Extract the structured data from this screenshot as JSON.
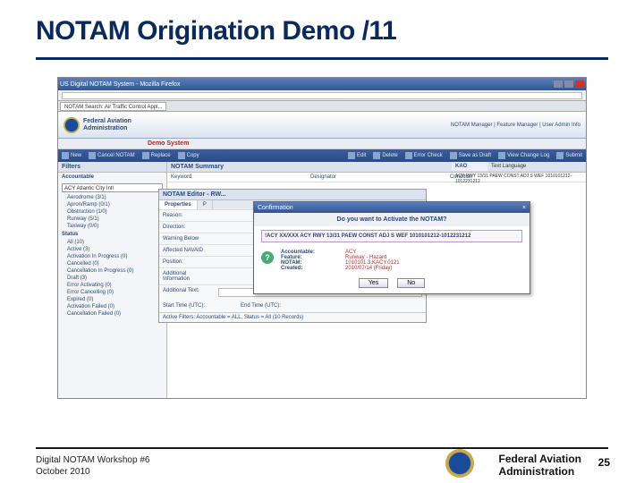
{
  "slide": {
    "title": "NOTAM Origination Demo /11",
    "page_number": "25"
  },
  "footer": {
    "line1": "Digital NOTAM Workshop #6",
    "line2": "October 2010",
    "agency_line1": "Federal Aviation",
    "agency_line2": "Administration"
  },
  "browser": {
    "window_title": "US Digital NOTAM System - Mozilla Firefox",
    "tab_label": "NOTAM Search: Air Traffic Control Appl..."
  },
  "app": {
    "brand_line1": "Federal Aviation",
    "brand_line2": "Administration",
    "right_links": "NOTAM Manager | Feature Manager | User Admin Info",
    "demo_banner": "Demo System"
  },
  "toolbar": {
    "new": "New",
    "cancel": "Cancel NOTAM",
    "replace": "Replace",
    "copy": "Copy",
    "edit": "Edit",
    "delete": "Delete",
    "errorcheck": "Error Check",
    "saveasdraft": "Save as Draft",
    "viewchangelog": "View Change Log",
    "submit": "Submit"
  },
  "sidebar": {
    "filters_label": "Filters",
    "accountable_label": "Accountable",
    "accountable_value": "ACY Atlantic City Intl",
    "status_label": "Status",
    "items": [
      "Aerodrome (3/1)",
      "Apron/Ramp (0/1)",
      "Obstruction (1/0)",
      "Runway (5/1)",
      "Taxiway (0/0)",
      "All (10)",
      "Active (3)",
      "Activation In Progress (0)",
      "Cancelled (0)",
      "Cancellation In Progress (0)",
      "Draft (3)",
      "Error Activating (0)",
      "Error Cancelling (0)",
      "Expired (0)",
      "Activation Failed (0)",
      "Cancellation Failed (0)"
    ]
  },
  "summary": {
    "header": "NOTAM Summary",
    "cols": [
      "Keyword",
      "Designator",
      "Condition"
    ],
    "kao_label": "KAO",
    "kao_text_label": "Text Language",
    "kao_text": "ACY RWY 13/31 PAEW CONST ADJ S WEF 1010101212-1012231212"
  },
  "editor": {
    "title": "NOTAM Editor - RW...",
    "tabs": [
      "Properties",
      "P"
    ],
    "rows": {
      "reason": "Reason:",
      "direction": "Direction:",
      "warning": "Warning Below",
      "affected": "Affected NAVAID",
      "position": "Position:",
      "additional_unk": "Additional Information",
      "additional_text": "Additional Text:"
    },
    "start_label": "Start Time (UTC):",
    "end_label": "End Time (UTC):",
    "footer": "Active Filters: Accountable = ALL, Status = All (10 Records)"
  },
  "dialog": {
    "title": "Confirmation",
    "question": "Do you want to Activate the NOTAM?",
    "highlight": "!ACY XX/XXX ACY RWY 13/31 PAEW CONST ADJ S WEF 1010101212-1012231212",
    "fields": {
      "accountable_l": "Accountable:",
      "accountable_r": "ACY",
      "feature_l": "Feature:",
      "feature_r": "Runway - Hazard",
      "notam_l": "NOTAM:",
      "notam_r": "1010101.3.KACY.0121",
      "created_l": "Created:",
      "created_r": "2010/07/14 (Friday)"
    },
    "yes": "Yes",
    "no": "No"
  }
}
